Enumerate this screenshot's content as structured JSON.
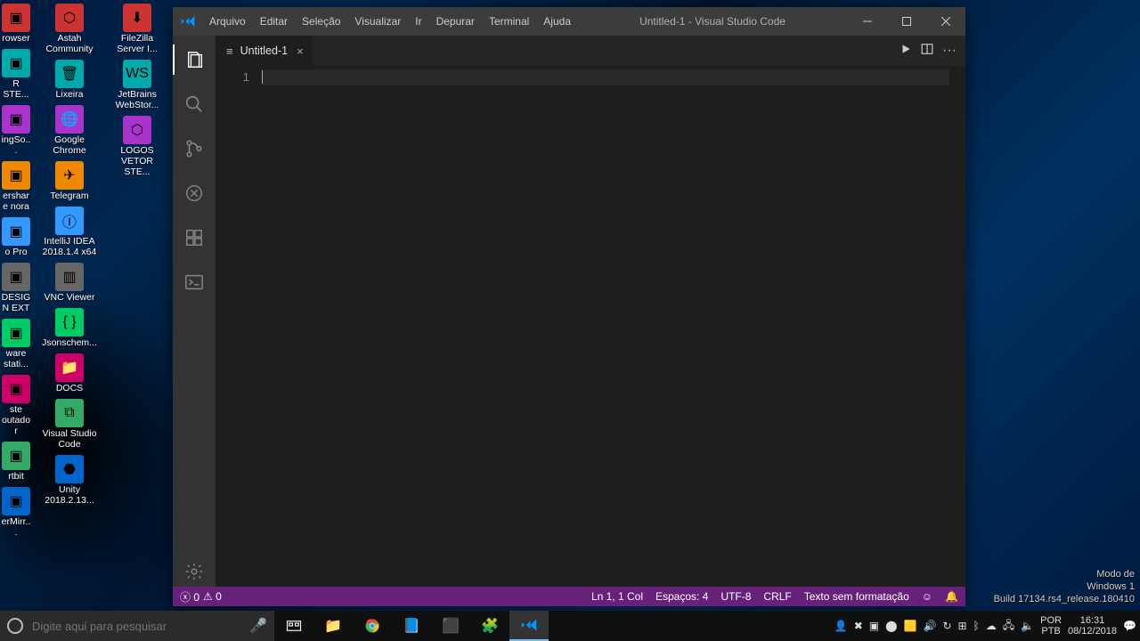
{
  "desktop": {
    "col0": [
      "rowser",
      "R STE...",
      "ingSo...",
      "ershare\nnora",
      "o Pro",
      "DESIGN\nEXT",
      "ware\nstati...",
      "ste\noutador",
      "rtbit",
      "erMirr..."
    ],
    "col1": [
      "Astah\nCommunity",
      "Lixeira",
      "Google\nChrome",
      "Telegram",
      "IntelliJ IDEA\n2018.1.4 x64",
      "VNC Viewer",
      "Jsonschem...",
      "DOCS",
      "Visual Studio\nCode",
      "Unity\n2018.2.13..."
    ],
    "col2": [
      "FileZilla\nServer I...",
      "JetBrains\nWebStor...",
      "LOGOS\nVETOR STE..."
    ]
  },
  "watermark": {
    "l1": "Modo de",
    "l2": "Windows 1",
    "l3": "Build 17134.rs4_release.180410"
  },
  "vscode": {
    "menu": [
      "Arquivo",
      "Editar",
      "Seleção",
      "Visualizar",
      "Ir",
      "Depurar",
      "Terminal",
      "Ajuda"
    ],
    "title": "Untitled-1 - Visual Studio Code",
    "tab": "Untitled-1",
    "line_no": "1",
    "status": {
      "errors": "0",
      "warnings": "0",
      "ln": "Ln 1, 1 Col",
      "spaces": "Espaços: 4",
      "enc": "UTF-8",
      "eol": "CRLF",
      "lang": "Texto sem formatação"
    }
  },
  "taskbar": {
    "search_placeholder": "Digite aqui para pesquisar",
    "lang1": "POR",
    "lang2": "PTB",
    "time": "16:31",
    "date": "08/12/2018"
  }
}
